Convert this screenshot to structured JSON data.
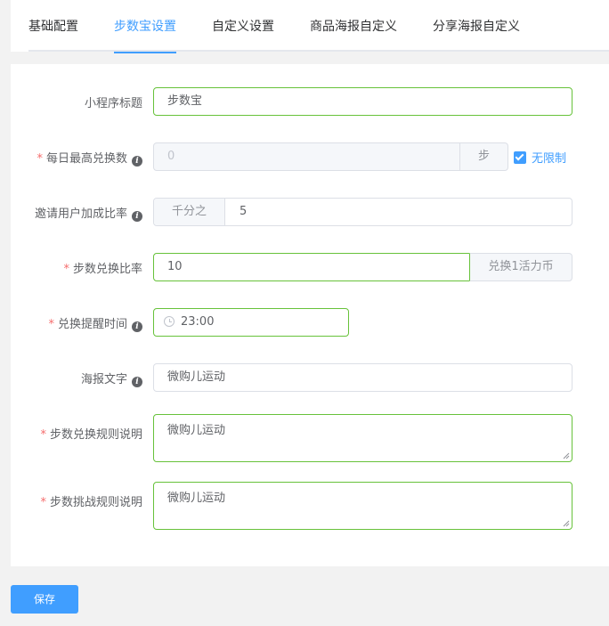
{
  "tabs": [
    {
      "label": "基础配置",
      "active": false
    },
    {
      "label": "步数宝设置",
      "active": true
    },
    {
      "label": "自定义设置",
      "active": false
    },
    {
      "label": "商品海报自定义",
      "active": false
    },
    {
      "label": "分享海报自定义",
      "active": false
    }
  ],
  "form": {
    "title": {
      "label": "小程序标题",
      "value": "步数宝"
    },
    "daily_max": {
      "label": "每日最高兑换数",
      "value": "0",
      "suffix": "步",
      "unlimited_label": "无限制",
      "unlimited_checked": true
    },
    "invite_ratio": {
      "label": "邀请用户加成比率",
      "prefix": "千分之",
      "value": "5"
    },
    "step_ratio": {
      "label": "步数兑换比率",
      "value": "10",
      "suffix": "兑换1活力币"
    },
    "remind_time": {
      "label": "兑换提醒时间",
      "value": "23:00"
    },
    "poster_text": {
      "label": "海报文字",
      "value": "微购儿运动"
    },
    "exchange_rules": {
      "label": "步数兑换规则说明",
      "value": "微购儿运动"
    },
    "challenge_rules": {
      "label": "步数挑战规则说明",
      "value": "微购儿运动"
    },
    "required_mark": "*",
    "info_glyph": "i"
  },
  "save_label": "保存",
  "colors": {
    "accent": "#409eff",
    "valid": "#67c23a",
    "required": "#f56c6c"
  }
}
